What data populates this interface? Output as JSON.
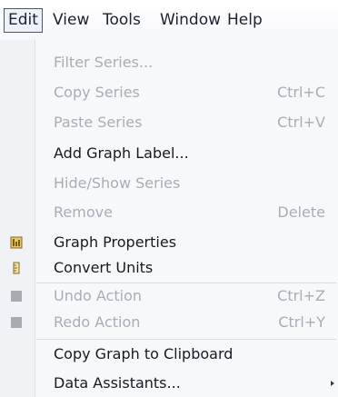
{
  "menubar": {
    "items": [
      {
        "label": "Edit"
      },
      {
        "label": "View"
      },
      {
        "label": "Tools"
      },
      {
        "label": "Window"
      },
      {
        "label": "Help"
      }
    ]
  },
  "edit_menu": {
    "items": [
      {
        "label": "Filter Series...",
        "shortcut": "",
        "enabled": false
      },
      {
        "label": "Copy Series",
        "shortcut": "Ctrl+C",
        "enabled": false
      },
      {
        "label": "Paste Series",
        "shortcut": "Ctrl+V",
        "enabled": false
      },
      {
        "label": "Add Graph Label...",
        "shortcut": "",
        "enabled": true
      },
      {
        "label": "Hide/Show Series",
        "shortcut": "",
        "enabled": false
      },
      {
        "label": "Remove",
        "shortcut": "Delete",
        "enabled": false
      },
      {
        "label": "Graph Properties",
        "shortcut": "",
        "enabled": true,
        "icon": "graph-properties-icon"
      },
      {
        "label": "Convert Units",
        "shortcut": "",
        "enabled": true,
        "icon": "convert-units-icon"
      },
      {
        "label": "Undo Action",
        "shortcut": "Ctrl+Z",
        "enabled": false,
        "icon": "undo-icon"
      },
      {
        "label": "Redo Action",
        "shortcut": "Ctrl+Y",
        "enabled": false,
        "icon": "redo-icon"
      },
      {
        "label": "Copy Graph to Clipboard",
        "shortcut": "",
        "enabled": true
      },
      {
        "label": "Data Assistants...",
        "shortcut": "",
        "enabled": true,
        "submenu": true
      }
    ]
  },
  "colors": {
    "menu_background": "#f7f8fa",
    "text_enabled": "#171a22",
    "text_disabled": "#a8adb7",
    "active_border": "#4f5764"
  }
}
